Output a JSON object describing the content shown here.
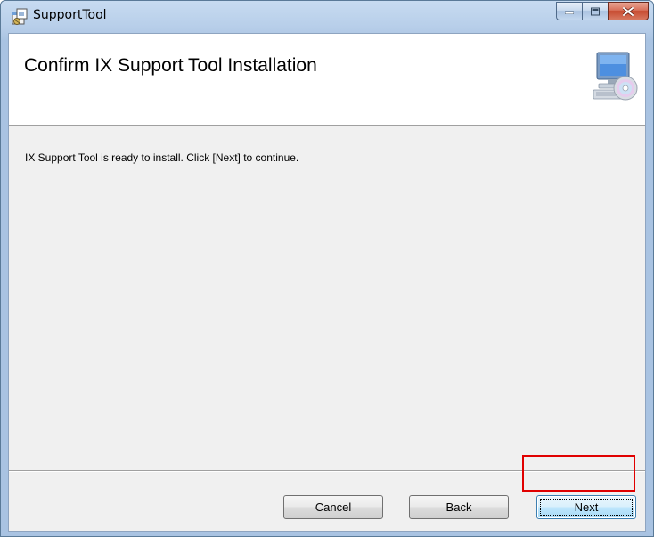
{
  "window": {
    "title": "SupportTool",
    "app_icon": "installer-package-icon",
    "caption_buttons": [
      "minimize-icon",
      "maximize-icon",
      "close-icon"
    ]
  },
  "banner": {
    "title": "Confirm IX Support Tool Installation",
    "icon": "computer-cd-icon"
  },
  "body": {
    "message": "IX Support Tool is ready to install. Click [Next] to continue."
  },
  "buttons": {
    "cancel_label": "Cancel",
    "back_label": "Back",
    "next_label": "Next"
  },
  "annotation": {
    "highlight_target": "next-button",
    "highlight_color": "#e00000"
  },
  "colors": {
    "title_bar": "#b7cee9",
    "client_background": "#f0f0f0",
    "banner_background": "#ffffff",
    "close_button": "#c74a30"
  }
}
